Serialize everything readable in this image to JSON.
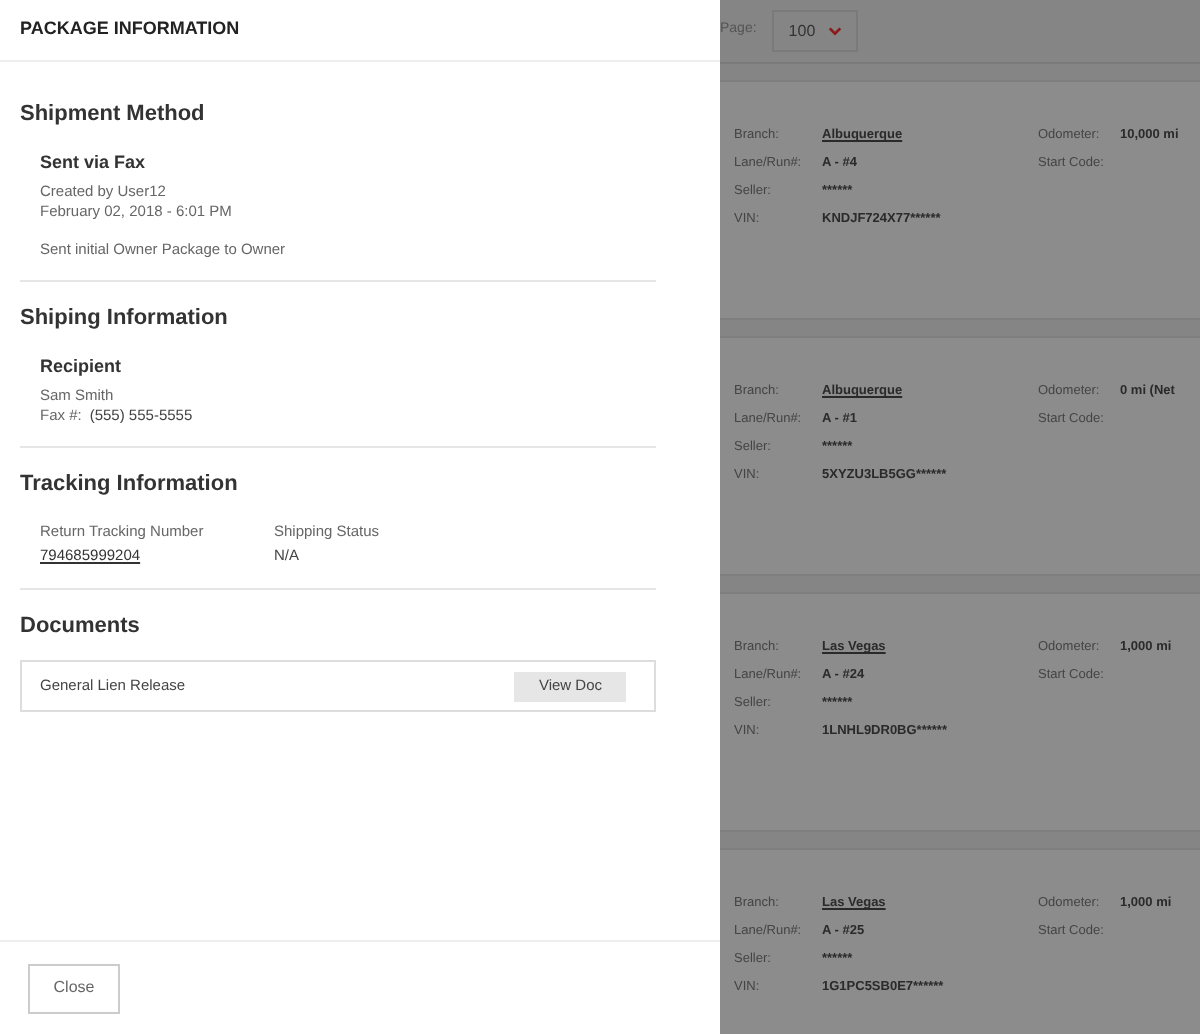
{
  "panel": {
    "title": "PACKAGE INFORMATION"
  },
  "shipment_method": {
    "heading": "Shipment Method",
    "method": "Sent via Fax",
    "created_by": "Created by User12",
    "date": "February 02, 2018 - 6:01 PM",
    "note": "Sent initial Owner Package to Owner"
  },
  "shipping_information": {
    "heading": "Shiping Information",
    "recipient_label": "Recipient",
    "name": "Sam Smith",
    "fax_label": "Fax #:",
    "fax": "(555) 555-5555"
  },
  "tracking_information": {
    "heading": "Tracking Information",
    "fields": [
      {
        "label": "Return Tracking Number",
        "value": "794685999204",
        "kind": "link"
      },
      {
        "label": "Shipping Status",
        "value": "N/A",
        "kind": "text"
      }
    ]
  },
  "documents": {
    "heading": "Documents",
    "items": [
      {
        "name": "General Lien Release",
        "button": "View Doc"
      }
    ]
  },
  "footer": {
    "close_button": "Close"
  },
  "background": {
    "page_label": "Page:",
    "page_size": "100",
    "vehicles": [
      {
        "left": [
          {
            "label": "Branch:",
            "value": "Albuquerque",
            "kind": "link"
          },
          {
            "label": "Lane/Run#:",
            "value": "A - #4",
            "kind": "text"
          },
          {
            "label": "Seller:",
            "value": "******",
            "kind": "text"
          },
          {
            "label": "VIN:",
            "value": "KNDJF724X77******",
            "kind": "text"
          }
        ],
        "right": [
          {
            "label": "Odometer:",
            "value": "10,000 mi"
          },
          {
            "label": "Start Code:"
          }
        ]
      },
      {
        "left": [
          {
            "label": "Branch:",
            "value": "Albuquerque",
            "kind": "link"
          },
          {
            "label": "Lane/Run#:",
            "value": "A - #1",
            "kind": "text"
          },
          {
            "label": "Seller:",
            "value": "******",
            "kind": "text"
          },
          {
            "label": "VIN:",
            "value": "5XYZU3LB5GG******",
            "kind": "text"
          }
        ],
        "right": [
          {
            "label": "Odometer:",
            "value": "0 mi (Net"
          },
          {
            "label": "Start Code:"
          }
        ]
      },
      {
        "left": [
          {
            "label": "Branch:",
            "value": "Las Vegas",
            "kind": "link"
          },
          {
            "label": "Lane/Run#:",
            "value": "A - #24",
            "kind": "text"
          },
          {
            "label": "Seller:",
            "value": "******",
            "kind": "text"
          },
          {
            "label": "VIN:",
            "value": "1LNHL9DR0BG******",
            "kind": "text"
          }
        ],
        "right": [
          {
            "label": "Odometer:",
            "value": "1,000 mi"
          },
          {
            "label": "Start Code:"
          }
        ]
      },
      {
        "left": [
          {
            "label": "Branch:",
            "value": "Las Vegas",
            "kind": "link"
          },
          {
            "label": "Lane/Run#:",
            "value": "A - #25",
            "kind": "text"
          },
          {
            "label": "Seller:",
            "value": "******",
            "kind": "text"
          },
          {
            "label": "VIN:",
            "value": "1G1PC5SB0E7******",
            "kind": "text"
          }
        ],
        "right": [
          {
            "label": "Odometer:",
            "value": "1,000 mi"
          },
          {
            "label": "Start Code:"
          }
        ]
      }
    ]
  }
}
